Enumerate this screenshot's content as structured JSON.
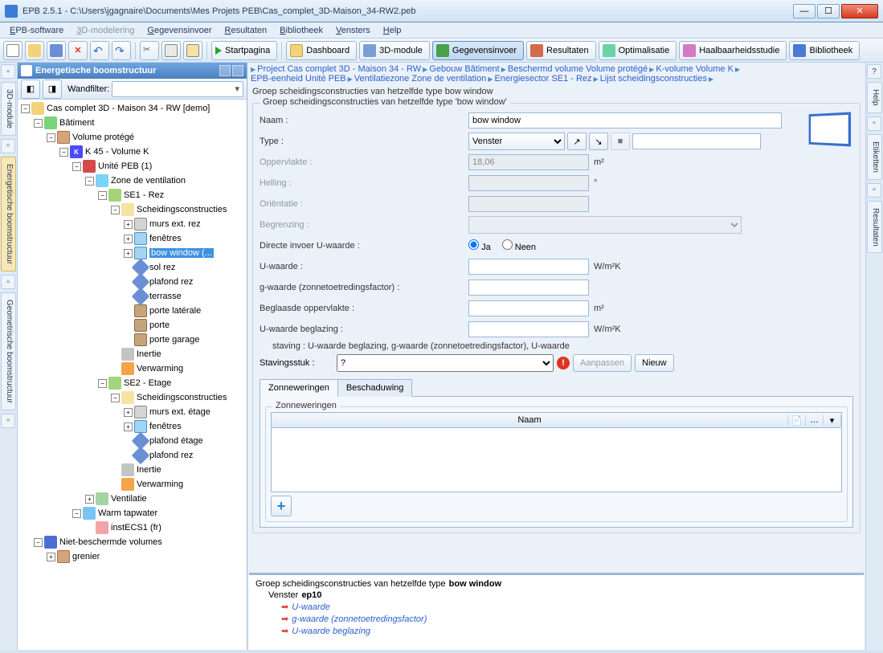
{
  "window": {
    "title": "EPB 2.5.1 - C:\\Users\\jgagnaire\\Documents\\Mes Projets PEB\\Cas_complet_3D-Maison_34-RW2.peb"
  },
  "menu": [
    "EPB-software",
    "3D-modelering",
    "Gegevensinvoer",
    "Resultaten",
    "Bibliotheek",
    "Vensters",
    "Help"
  ],
  "toolbar": {
    "start": "Startpagina",
    "dashboard": "Dashboard",
    "module3d": "3D-module",
    "data": "Gegevensinvoer",
    "results": "Resultaten",
    "opt": "Optimalisatie",
    "feas": "Haalbaarheidsstudie",
    "lib": "Bibliotheek"
  },
  "leftTabs": {
    "t1": "3D-module",
    "t2": "Energetische boomstructuur",
    "t3": "Geometrische boomstructuur"
  },
  "rightTabs": {
    "t1": "Help",
    "t2": "Etiketten",
    "t3": "Resultaten"
  },
  "treePanel": {
    "title": "Energetische boomstructuur",
    "filterLabel": "Wandfilter:",
    "nodes": {
      "root": "Cas complet 3D - Maison 34 - RW [demo]",
      "bldg": "Bâtiment",
      "vol": "Volume protégé",
      "k": "K 45 - Volume K",
      "unit": "Unité PEB (1)",
      "zone": "Zone de ventilation",
      "se1": "SE1 - Rez",
      "scheid1": "Scheidingsconstructies",
      "murs1": "murs ext. rez",
      "fen1": "fenêtres",
      "bow": "bow window (...",
      "sol": "sol rez",
      "plaf1": "plafond rez",
      "terr": "terrasse",
      "portel": "porte latérale",
      "porte": "porte",
      "porteg": "porte garage",
      "inert1": "Inertie",
      "verw1": "Verwarming",
      "se2": "SE2 - Etage",
      "scheid2": "Scheidingsconstructies",
      "murs2": "murs ext. étage",
      "fen2": "fenêtres",
      "plaf2": "plafond étage",
      "plaf3": "plafond rez",
      "inert2": "Inertie",
      "verw2": "Verwarming",
      "vent": "Ventilatie",
      "water": "Warm tapwater",
      "ecs": "instECS1 (fr)",
      "nvol": "Niet-beschermde volumes",
      "gren": "grenier"
    }
  },
  "breadcrumb": {
    "l1": [
      "Project Cas complet 3D - Maison 34 - RW",
      "Gebouw Bâtiment",
      "Beschermd volume Volume protégé",
      "K-volume Volume K"
    ],
    "l2": [
      "EPB-eenheid Unité PEB",
      "Ventilatiezone Zone de ventilation",
      "Energiesector SE1 - Rez",
      "Lijst scheidingsconstructies"
    ]
  },
  "subhead": "Groep scheidingsconstructies van hetzelfde type bow window",
  "form": {
    "legend": "Groep scheidingsconstructies van hetzelfde type 'bow window'",
    "naam_lbl": "Naam :",
    "naam_val": "bow window",
    "type_lbl": "Type :",
    "type_val": "Venster",
    "opp_lbl": "Oppervlakte :",
    "opp_val": "18,06",
    "opp_unit": "m²",
    "helling_lbl": "Helling :",
    "helling_unit": "°",
    "orient_lbl": "Oriëntatie :",
    "begrenz_lbl": "Begrenzing  :",
    "directe_lbl": "Directe invoer U-waarde :",
    "ja": "Ja",
    "neen": "Neen",
    "uw_lbl": "U-waarde :",
    "uw_unit": "W/m²K",
    "gw_lbl": "g-waarde (zonnetoetredingsfactor) :",
    "beg_opp_lbl": "Beglaasde oppervlakte :",
    "beg_opp_unit": "m²",
    "uwb_lbl": "U-waarde beglazing :",
    "uwb_unit": "W/m²K",
    "staving_warn": "staving : U-waarde beglazing, g-waarde (zonnetoetredingsfactor), U-waarde",
    "staving_lbl": "Stavingsstuk :",
    "staving_val": "?",
    "aanpassen": "Aanpassen",
    "nieuw": "Nieuw"
  },
  "tabs": {
    "t1": "Zonneweringen",
    "t2": "Beschaduwing",
    "inner_legend": "Zonneweringen",
    "col": "Naam"
  },
  "errPanel": {
    "l1a": "Groep scheidingsconstructies van hetzelfde type ",
    "l1b": "bow window",
    "l2a": "Venster ",
    "l2b": "ep10",
    "e1": "U-waarde",
    "e2": "g-waarde (zonnetoetredingsfactor)",
    "e3": "U-waarde beglazing"
  }
}
